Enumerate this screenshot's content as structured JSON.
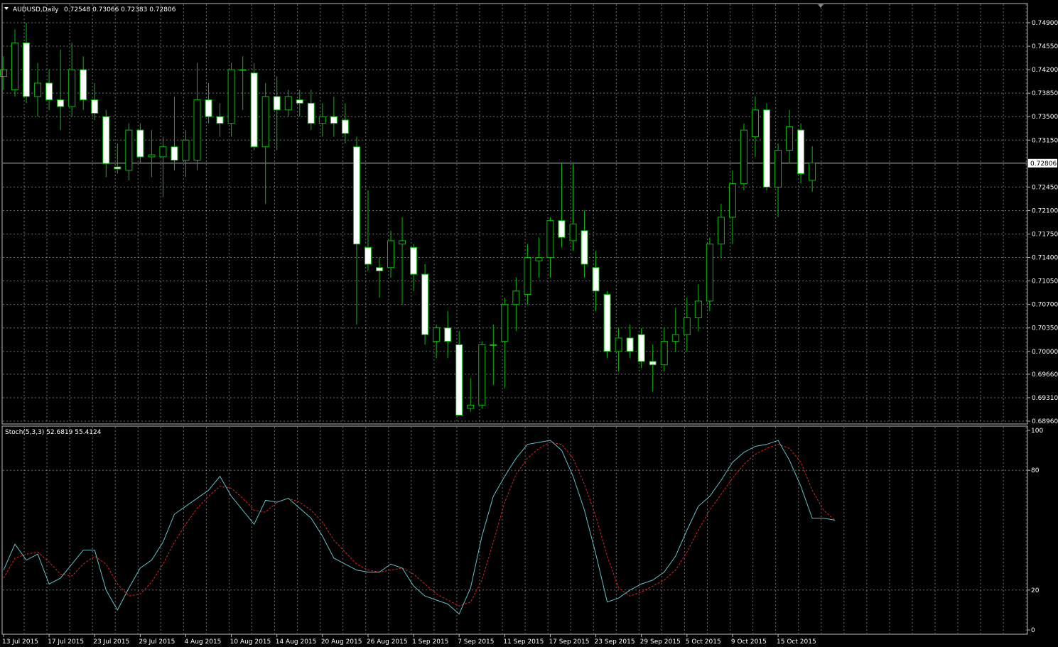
{
  "window": {
    "symbol_label": "AUDUSD,Daily",
    "ohlc_readout": "0.72548 0.73066 0.72383 0.72806",
    "indicator_label": "Stoch(5,3,3) 52.6819 55.4124",
    "current_price_label": "0.72806"
  },
  "colors": {
    "background": "#000000",
    "candle_bull_body": "#000000",
    "candle_bear_body": "#ffffff",
    "candle_outline": "#00c000",
    "grid": "#c8c8c8",
    "stoch_main": "#5fc0c8",
    "stoch_signal": "#e02020",
    "axis_text": "#ffffff"
  },
  "chart_data": [
    {
      "type": "candlestick",
      "symbol": "AUDUSD",
      "timeframe": "Daily",
      "y_ticks": [
        "0.74900",
        "0.74550",
        "0.74200",
        "0.73850",
        "0.73500",
        "0.73150",
        "0.72450",
        "0.72100",
        "0.71750",
        "0.71400",
        "0.71050",
        "0.70700",
        "0.70350",
        "0.70000",
        "0.69660",
        "0.69310",
        "0.68960"
      ],
      "ylim": [
        0.6896,
        0.749
      ],
      "current_price": 0.72806,
      "x_labels": [
        "13 Jul 2015",
        "17 Jul 2015",
        "23 Jul 2015",
        "29 Jul 2015",
        "4 Aug 2015",
        "10 Aug 2015",
        "14 Aug 2015",
        "20 Aug 2015",
        "26 Aug 2015",
        "1 Sep 2015",
        "7 Sep 2015",
        "11 Sep 2015",
        "17 Sep 2015",
        "23 Sep 2015",
        "29 Sep 2015",
        "5 Oct 2015",
        "9 Oct 2015",
        "15 Oct 2015"
      ],
      "x_label_every": 4,
      "ohlc": [
        [
          0.741,
          0.744,
          0.739,
          0.742
        ],
        [
          0.739,
          0.748,
          0.738,
          0.746
        ],
        [
          0.746,
          0.749,
          0.737,
          0.738
        ],
        [
          0.738,
          0.743,
          0.735,
          0.74
        ],
        [
          0.74,
          0.742,
          0.736,
          0.7375
        ],
        [
          0.7375,
          0.745,
          0.733,
          0.7365
        ],
        [
          0.7365,
          0.746,
          0.735,
          0.742
        ],
        [
          0.742,
          0.744,
          0.736,
          0.7375
        ],
        [
          0.7375,
          0.74,
          0.7345,
          0.7355
        ],
        [
          0.735,
          0.736,
          0.726,
          0.728
        ],
        [
          0.7275,
          0.731,
          0.7265,
          0.7272
        ],
        [
          0.727,
          0.734,
          0.7255,
          0.733
        ],
        [
          0.733,
          0.734,
          0.728,
          0.729
        ],
        [
          0.729,
          0.733,
          0.726,
          0.7293
        ],
        [
          0.729,
          0.732,
          0.723,
          0.7305
        ],
        [
          0.7305,
          0.738,
          0.727,
          0.7285
        ],
        [
          0.7285,
          0.733,
          0.726,
          0.7315
        ],
        [
          0.7285,
          0.743,
          0.727,
          0.7375
        ],
        [
          0.7375,
          0.74,
          0.734,
          0.735
        ],
        [
          0.735,
          0.737,
          0.732,
          0.734
        ],
        [
          0.734,
          0.743,
          0.732,
          0.742
        ],
        [
          0.742,
          0.744,
          0.736,
          0.742
        ],
        [
          0.7415,
          0.743,
          0.73,
          0.7305
        ],
        [
          0.7305,
          0.74,
          0.722,
          0.738
        ],
        [
          0.738,
          0.741,
          0.73,
          0.736
        ],
        [
          0.736,
          0.739,
          0.735,
          0.738
        ],
        [
          0.7375,
          0.739,
          0.735,
          0.737
        ],
        [
          0.737,
          0.739,
          0.733,
          0.734
        ],
        [
          0.734,
          0.737,
          0.732,
          0.735
        ],
        [
          0.735,
          0.738,
          0.732,
          0.734
        ],
        [
          0.7345,
          0.737,
          0.731,
          0.7325
        ],
        [
          0.7305,
          0.732,
          0.704,
          0.716
        ],
        [
          0.7155,
          0.724,
          0.712,
          0.713
        ],
        [
          0.7125,
          0.714,
          0.708,
          0.712
        ],
        [
          0.7125,
          0.718,
          0.711,
          0.7165
        ],
        [
          0.716,
          0.72,
          0.707,
          0.7165
        ],
        [
          0.7155,
          0.716,
          0.709,
          0.7115
        ],
        [
          0.7115,
          0.713,
          0.701,
          0.7025
        ],
        [
          0.7015,
          0.704,
          0.699,
          0.7035
        ],
        [
          0.7035,
          0.706,
          0.699,
          0.7015
        ],
        [
          0.701,
          0.703,
          0.6905,
          0.6905
        ],
        [
          0.6915,
          0.696,
          0.691,
          0.692
        ],
        [
          0.692,
          0.7015,
          0.6915,
          0.701
        ],
        [
          0.701,
          0.704,
          0.695,
          0.701
        ],
        [
          0.7015,
          0.708,
          0.6945,
          0.707
        ],
        [
          0.707,
          0.711,
          0.703,
          0.709
        ],
        [
          0.7085,
          0.716,
          0.707,
          0.714
        ],
        [
          0.7135,
          0.717,
          0.711,
          0.714
        ],
        [
          0.714,
          0.72,
          0.711,
          0.7195
        ],
        [
          0.7195,
          0.728,
          0.7155,
          0.717
        ],
        [
          0.7165,
          0.728,
          0.715,
          0.719
        ],
        [
          0.718,
          0.721,
          0.711,
          0.713
        ],
        [
          0.7125,
          0.715,
          0.706,
          0.709
        ],
        [
          0.7085,
          0.709,
          0.699,
          0.7
        ],
        [
          0.7,
          0.7035,
          0.697,
          0.702
        ],
        [
          0.702,
          0.704,
          0.699,
          0.7
        ],
        [
          0.7025,
          0.7035,
          0.6975,
          0.6985
        ],
        [
          0.6985,
          0.701,
          0.694,
          0.698
        ],
        [
          0.698,
          0.7035,
          0.697,
          0.7015
        ],
        [
          0.7015,
          0.7065,
          0.7,
          0.7025
        ],
        [
          0.7025,
          0.708,
          0.7,
          0.705
        ],
        [
          0.705,
          0.71,
          0.703,
          0.7075
        ],
        [
          0.7075,
          0.717,
          0.706,
          0.716
        ],
        [
          0.716,
          0.722,
          0.714,
          0.72
        ],
        [
          0.72,
          0.727,
          0.716,
          0.725
        ],
        [
          0.725,
          0.734,
          0.724,
          0.733
        ],
        [
          0.732,
          0.738,
          0.729,
          0.736
        ],
        [
          0.736,
          0.737,
          0.724,
          0.7245
        ],
        [
          0.7245,
          0.731,
          0.72,
          0.73
        ],
        [
          0.73,
          0.736,
          0.728,
          0.7335
        ],
        [
          0.733,
          0.734,
          0.725,
          0.7265
        ],
        [
          0.7255,
          0.7306,
          0.7238,
          0.7281
        ]
      ]
    },
    {
      "type": "line",
      "indicator": "Stoch(5,3,3)",
      "ylim": [
        0,
        100
      ],
      "y_ticks": [
        "100",
        "80",
        "20",
        "0"
      ],
      "series": [
        {
          "name": "main",
          "values": [
            30,
            43,
            35,
            38,
            23,
            26,
            33,
            40,
            40,
            20,
            10,
            21,
            31,
            35,
            44,
            58,
            62,
            66,
            70,
            77,
            67,
            60,
            53,
            65,
            64,
            66,
            61,
            56,
            47,
            36,
            33,
            30,
            29,
            29,
            33,
            31,
            22,
            17,
            15,
            13,
            8,
            21,
            47,
            67,
            77,
            86,
            93,
            94,
            95,
            90,
            77,
            60,
            38,
            14,
            16,
            20,
            23,
            25,
            29,
            37,
            50,
            62,
            67,
            75,
            84,
            89,
            92,
            93,
            95,
            85,
            72,
            56,
            56,
            55
          ]
        },
        {
          "name": "signal",
          "values": [
            26,
            36,
            38,
            39,
            34,
            28,
            27,
            33,
            37,
            33,
            23,
            17,
            18,
            24,
            33,
            44,
            53,
            61,
            67,
            72,
            71,
            66,
            60,
            59,
            64,
            66,
            64,
            60,
            54,
            45,
            39,
            33,
            30,
            29,
            30,
            31,
            28,
            23,
            18,
            15,
            12,
            14,
            25,
            44,
            64,
            78,
            86,
            91,
            94,
            93,
            86,
            73,
            57,
            37,
            21,
            17,
            19,
            22,
            25,
            30,
            39,
            50,
            60,
            68,
            76,
            83,
            88,
            91,
            93,
            91,
            84,
            70,
            60,
            55
          ]
        }
      ]
    }
  ]
}
